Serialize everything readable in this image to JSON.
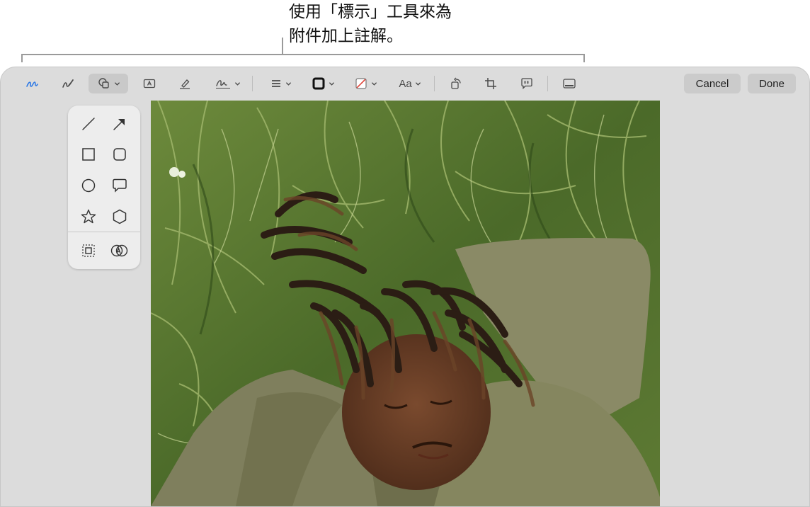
{
  "callout": {
    "line1": "使用「標示」工具來為",
    "line2": "附件加上註解。"
  },
  "toolbar": {
    "tools": [
      {
        "name": "sketch-icon",
        "active": true
      },
      {
        "name": "draw-icon",
        "active": false
      },
      {
        "name": "shapes-icon",
        "active": false
      },
      {
        "name": "text-box-icon",
        "active": false
      },
      {
        "name": "highlight-icon",
        "active": false
      },
      {
        "name": "sign-icon",
        "active": false
      },
      {
        "name": "shape-style-icon",
        "active": false
      },
      {
        "name": "border-color-icon",
        "active": false
      },
      {
        "name": "fill-color-icon",
        "active": false
      },
      {
        "name": "text-style-icon",
        "active": false
      },
      {
        "name": "rotate-icon",
        "active": false
      },
      {
        "name": "crop-icon",
        "active": false
      },
      {
        "name": "description-icon",
        "active": false
      },
      {
        "name": "image-description-icon",
        "active": false
      }
    ],
    "text_style_label": "Aa",
    "cancel_label": "Cancel",
    "done_label": "Done"
  },
  "shapes_panel": {
    "items": [
      "line",
      "arrow",
      "square",
      "rounded-square",
      "circle",
      "speech-bubble",
      "star",
      "hexagon",
      "loupe",
      "mask"
    ]
  },
  "colors": {
    "accent": "#2f7ae5",
    "window_bg": "#dcdcdc",
    "button_bg": "#cbcbcb"
  }
}
